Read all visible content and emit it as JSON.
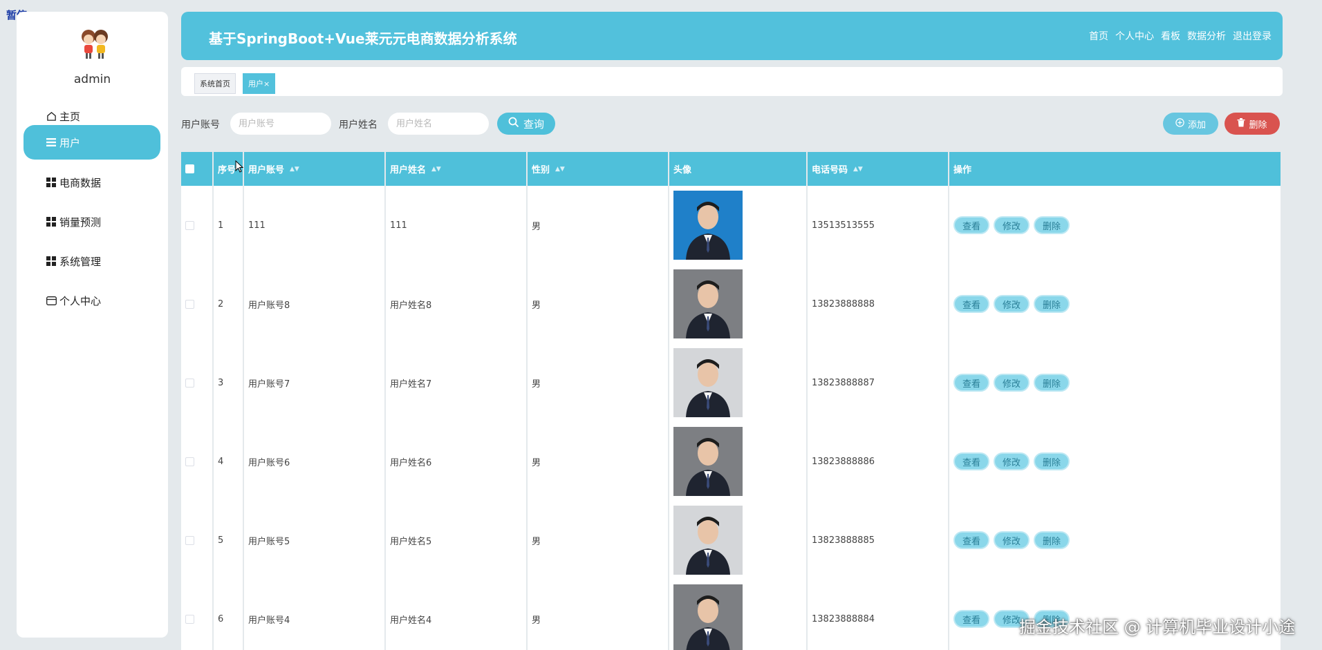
{
  "overlay": {
    "paused_label": "暂停",
    "watermark": "掘金技术社区 @ 计算机毕业设计小途"
  },
  "sidebar": {
    "username": "admin",
    "items": [
      {
        "label": "主页",
        "icon": "home-icon"
      },
      {
        "label": "用户",
        "icon": "menu-lines-icon",
        "active": true
      },
      {
        "label": "电商数据",
        "icon": "grid-icon"
      },
      {
        "label": "销量预测",
        "icon": "grid-icon"
      },
      {
        "label": "系统管理",
        "icon": "grid-icon"
      },
      {
        "label": "个人中心",
        "icon": "card-icon"
      }
    ]
  },
  "header": {
    "title": "基于SpringBoot+Vue莱元元电商数据分析系统",
    "links": [
      "首页",
      "个人中心",
      "看板",
      "数据分析",
      "退出登录"
    ]
  },
  "tags": [
    {
      "label": "系统首页"
    },
    {
      "label": "用户×",
      "active": true
    }
  ],
  "search": {
    "account_label": "用户账号",
    "account_placeholder": "用户账号",
    "name_label": "用户姓名",
    "name_placeholder": "用户姓名",
    "query_button": "查询",
    "add_button": "添加",
    "delete_button": "删除"
  },
  "table": {
    "headers": [
      "序号",
      "用户账号",
      "用户姓名",
      "性别",
      "头像",
      "电话号码",
      "操作"
    ],
    "actions": [
      "查看",
      "修改",
      "删除"
    ],
    "rows": [
      {
        "index": "1",
        "account": "111",
        "name": "111",
        "gender": "男",
        "phone": "13513513555",
        "photo": "blue"
      },
      {
        "index": "2",
        "account": "用户账号8",
        "name": "用户姓名8",
        "gender": "男",
        "phone": "13823888888",
        "photo": "grey"
      },
      {
        "index": "3",
        "account": "用户账号7",
        "name": "用户姓名7",
        "gender": "男",
        "phone": "13823888887",
        "photo": "light"
      },
      {
        "index": "4",
        "account": "用户账号6",
        "name": "用户姓名6",
        "gender": "男",
        "phone": "13823888886",
        "photo": "grey"
      },
      {
        "index": "5",
        "account": "用户账号5",
        "name": "用户姓名5",
        "gender": "男",
        "phone": "13823888885",
        "photo": "light"
      },
      {
        "index": "6",
        "account": "用户账号4",
        "name": "用户姓名4",
        "gender": "男",
        "phone": "13823888884",
        "photo": "grey"
      }
    ]
  },
  "colors": {
    "accent": "#4fc0da",
    "header": "#52c1dc",
    "danger": "#d9534f",
    "background": "#e4e9ec"
  }
}
